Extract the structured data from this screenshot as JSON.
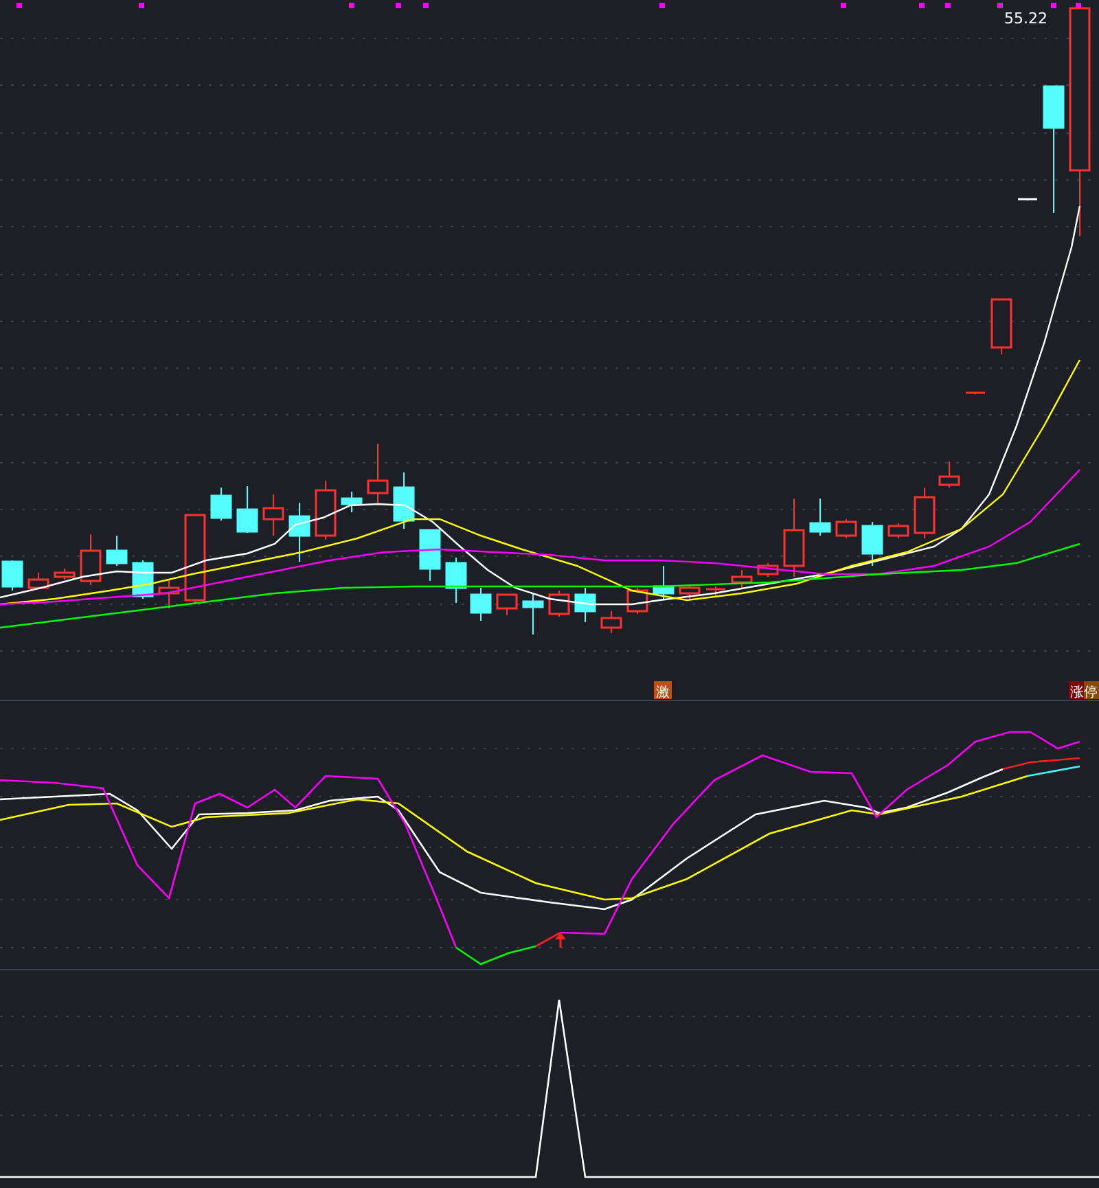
{
  "price_chart": {
    "high_label": "55.22",
    "signal_labels": [
      {
        "text": "激",
        "kind": "signal"
      },
      {
        "text": "涨停",
        "kind": "limit_up"
      }
    ]
  }
}
